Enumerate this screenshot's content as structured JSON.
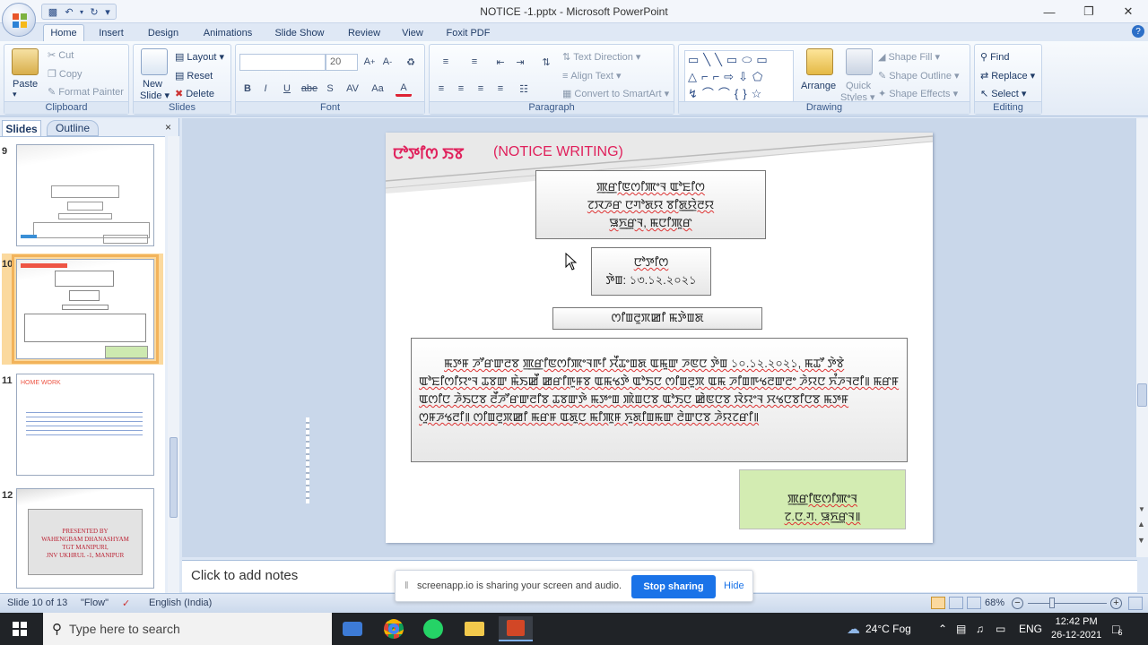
{
  "app": {
    "window_title": "NOTICE -1.pptx - Microsoft PowerPoint",
    "qat_dropdown": "▾"
  },
  "tabs": [
    "Home",
    "Insert",
    "Design",
    "Animations",
    "Slide Show",
    "Review",
    "View",
    "Foxit PDF"
  ],
  "ribbon": {
    "clipboard": {
      "label": "Clipboard",
      "paste": "Paste",
      "cut": "Cut",
      "copy": "Copy",
      "format_painter": "Format Painter"
    },
    "slides": {
      "label": "Slides",
      "new_slide_1": "New",
      "new_slide_2": "Slide ▾",
      "layout": "Layout ▾",
      "reset": "Reset",
      "delete": "Delete"
    },
    "font": {
      "label": "Font",
      "font_name": "",
      "font_size": "20"
    },
    "paragraph": {
      "label": "Paragraph",
      "text_direction": "Text Direction ▾",
      "align_text": "Align Text ▾",
      "convert_smartart": "Convert to SmartArt ▾"
    },
    "drawing": {
      "label": "Drawing",
      "arrange": "Arrange",
      "quick_styles_1": "Quick",
      "quick_styles_2": "Styles ▾",
      "shape_fill": "Shape Fill ▾",
      "shape_outline": "Shape Outline ▾",
      "shape_effects": "Shape Effects ▾"
    },
    "editing": {
      "label": "Editing",
      "find": "Find",
      "replace": "Replace ▾",
      "select": "Select ▾"
    }
  },
  "left_pane": {
    "tab_slides": "Slides",
    "tab_outline": "Outline",
    "slide_numbers": [
      "9",
      "10",
      "11",
      "12"
    ],
    "thumb11_title": "HOME WORK",
    "thumb12_text": [
      "PRESENTED BY",
      "WAHENGBAM DHANASHYAM",
      "TGT MANIPURI,",
      "JNV UKHRUL -1, MANIPUR"
    ]
  },
  "slide": {
    "title_script": "ꯅꯣꯇꯤꯁ ꯏꯕ",
    "title_latin": "(NOTICE WRITING)",
    "box1": [
      "ꯄ꯭ꯔꯤꯟꯁꯤꯄꯦꯜ ꯑꯣꯐꯤꯁ",
      "ꯖꯋꯍꯔ ꯅꯚꯣꯗꯌ ꯕꯤꯗ꯭ꯌꯥꯂꯌ",
      "ꯎꯈ꯭ꯔꯨꯜ, ꯃꯅꯤꯄꯨꯔ"
    ],
    "box2": [
      "ꯅꯣꯇꯤꯁ",
      "ꯇꯥꯡ: ১৩.১২.২০২১"
    ],
    "box3": "ꯁꯤꯡꯂꯨꯞꯀꯤ ꯃꯇꯥꯡꯗ",
    "body": "ꯃꯇꯝ ꯍꯧꯔꯛꯂꯕ ꯄ꯭ꯔꯤꯟꯁꯤꯄꯦꯜꯒꯤ ꯆꯩꯊꯦꯡꯗ ꯑꯃꯨꯛ ꯍꯟꯅ ꯇꯥꯡ ১০.১২.২০২১, ꯃꯊꯧ ꯇꯥꯕꯥ ꯑꯣꯐꯤꯁꯤꯌꯦꯜ ꯊꯕꯛ ꯃꯥꯏꯀꯩ ꯀꯔꯤꯒꯨꯝꯕ ꯑꯃꯠꯇꯥ ꯑꯣꯏꯅ ꯁꯤꯡꯂꯨꯞ ꯑꯃ ꯍꯤꯡꯒꯠꯂꯛꯂꯦ ꯍꯥꯌꯅ ꯈꯪꯍꯜꯂꯤ꯫ ꯃꯔꯝ ꯑꯁꯤꯅ ꯍꯥꯏꯅꯕ ꯂꯩꯍꯧꯔꯛꯂꯤꯕ ꯊꯕꯛꯇꯥ ꯃꯇꯦꯡ ꯄꯥꯡꯅꯕ ꯑꯣꯏꯅ ꯀꯥꯟꯅꯕ ꯋꯥꯌꯦꯜ ꯆꯠꯅꯕꯤꯅꯕ ꯃꯇꯝ ꯁꯨꯝꯍꯠꯂꯤ꯫ ꯁꯤꯡꯂꯨꯞꯀꯤ ꯃꯔꯝ ꯑꯗꯨꯅ ꯃꯤꯄꯨꯝ ꯈꯨꯗꯤꯡꯃꯛ ꯂꯥꯛꯅꯕ ꯍꯥꯌꯖꯔꯤ꯫",
    "sign": [
      "ꯄ꯭ꯔꯤꯟꯁꯤꯄꯦꯜ",
      "ꯖ.ꯅ.ꯚ. ꯎꯈ꯭ꯔꯨꯜ꯫"
    ]
  },
  "notes": {
    "placeholder": "Click to add notes"
  },
  "status": {
    "slide_count": "Slide 10 of 13",
    "theme": "\"Flow\"",
    "language": "English (India)",
    "zoom": "68%"
  },
  "sharebar": {
    "message": "screenapp.io is sharing your screen and audio.",
    "stop": "Stop sharing",
    "hide": "Hide"
  },
  "taskbar": {
    "search_placeholder": "Type here to search",
    "weather": "24°C  Fog",
    "lang": "ENG",
    "time": "12:42 PM",
    "date": "26-12-2021",
    "notif_count": "6"
  }
}
